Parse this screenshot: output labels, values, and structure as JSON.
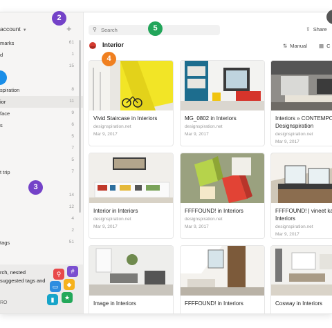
{
  "sidebar": {
    "account_label": "account",
    "add_icon": "plus-icon",
    "items": [
      {
        "label": "marks",
        "count": "61"
      },
      {
        "label": "d",
        "count": "1"
      },
      {
        "label": "",
        "count": "15"
      },
      {
        "label": "",
        "count": ""
      },
      {
        "label": "spiration",
        "count": "8"
      },
      {
        "label": "ior",
        "count": "11"
      },
      {
        "label": "face",
        "count": "9"
      },
      {
        "label": "s",
        "count": "6"
      },
      {
        "label": "",
        "count": "5"
      },
      {
        "label": "",
        "count": "7"
      },
      {
        "label": "",
        "count": "5"
      },
      {
        "label": "t trip",
        "count": "7"
      },
      {
        "label": "",
        "count": ""
      },
      {
        "label": "",
        "count": "14"
      },
      {
        "label": "",
        "count": "12"
      },
      {
        "label": "",
        "count": "4"
      },
      {
        "label": "",
        "count": "2"
      },
      {
        "label": "tags",
        "count": "51"
      }
    ],
    "promo": {
      "text": "rch, nested suggested tags and",
      "pro_label": "RO"
    }
  },
  "badges": {
    "b2": "2",
    "b3": "3",
    "b4": "4",
    "b5": "5"
  },
  "toolbar": {
    "search_placeholder": "Search",
    "share_label": "Share"
  },
  "collection": {
    "title": "Interior",
    "view_label": "Manual",
    "sort_label": "C"
  },
  "cards": [
    {
      "title": "Vivid Staircase in Interiors",
      "source": "designspiration.net",
      "date": "Mar 9, 2017"
    },
    {
      "title": "MG_0802 in Interiors",
      "source": "designspiration.net",
      "date": "Mar 9, 2017"
    },
    {
      "title": "Interiors » CONTEMPO on Designspiration",
      "source": "designspiration.net",
      "date": "Mar 9, 2017"
    },
    {
      "title": "Interior in Interiors",
      "source": "designspiration.net",
      "date": "Mar 9, 2017"
    },
    {
      "title": "FFFFOUND! in Interiors",
      "source": "designspiration.net",
      "date": "Mar 9, 2017"
    },
    {
      "title": "FFFFOUND! | vineet ka Interiors",
      "source": "designspiration.net",
      "date": "Mar 9, 2017"
    },
    {
      "title": "Image in Interiors",
      "source": "",
      "date": ""
    },
    {
      "title": "FFFFOUND! in Interiors",
      "source": "",
      "date": ""
    },
    {
      "title": "Cosway in Interiors",
      "source": "",
      "date": ""
    }
  ],
  "colors": {
    "badge_purple": "#7442c8",
    "badge_green": "#22a55a",
    "badge_orange": "#f08020",
    "badge_blue": "#1a8ee8"
  }
}
